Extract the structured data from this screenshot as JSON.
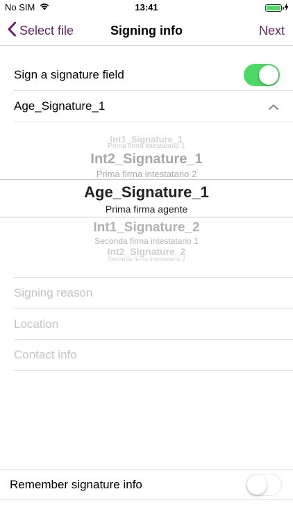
{
  "status": {
    "carrier": "No SIM",
    "time": "13:41",
    "battery_level": 1.0
  },
  "nav": {
    "back_label": "Select file",
    "title": "Signing info",
    "next_label": "Next",
    "accent": "#6b1f6b"
  },
  "sign_field": {
    "label": "Sign a signature field",
    "enabled": true,
    "toggle_color": "#4cd964"
  },
  "selected_field": {
    "label": "Age_Signature_1"
  },
  "picker": {
    "items": [
      {
        "name": "Int1_Signature_1",
        "desc": "Prima firma intestatario 1"
      },
      {
        "name": "Int2_Signature_1",
        "desc": "Prima firma intestatario 2"
      },
      {
        "name": "Age_Signature_1",
        "desc": "Prima firma agente"
      },
      {
        "name": "Int1_Signature_2",
        "desc": "Seconda firma intestatario 1"
      },
      {
        "name": "Int2_Signature_2",
        "desc": "Seconda firma intestatario 2"
      }
    ],
    "selected_index": 2
  },
  "fields": {
    "reason_placeholder": "Signing reason",
    "location_placeholder": "Location",
    "contact_placeholder": "Contact info"
  },
  "remember": {
    "label": "Remember signature info",
    "enabled": false
  }
}
